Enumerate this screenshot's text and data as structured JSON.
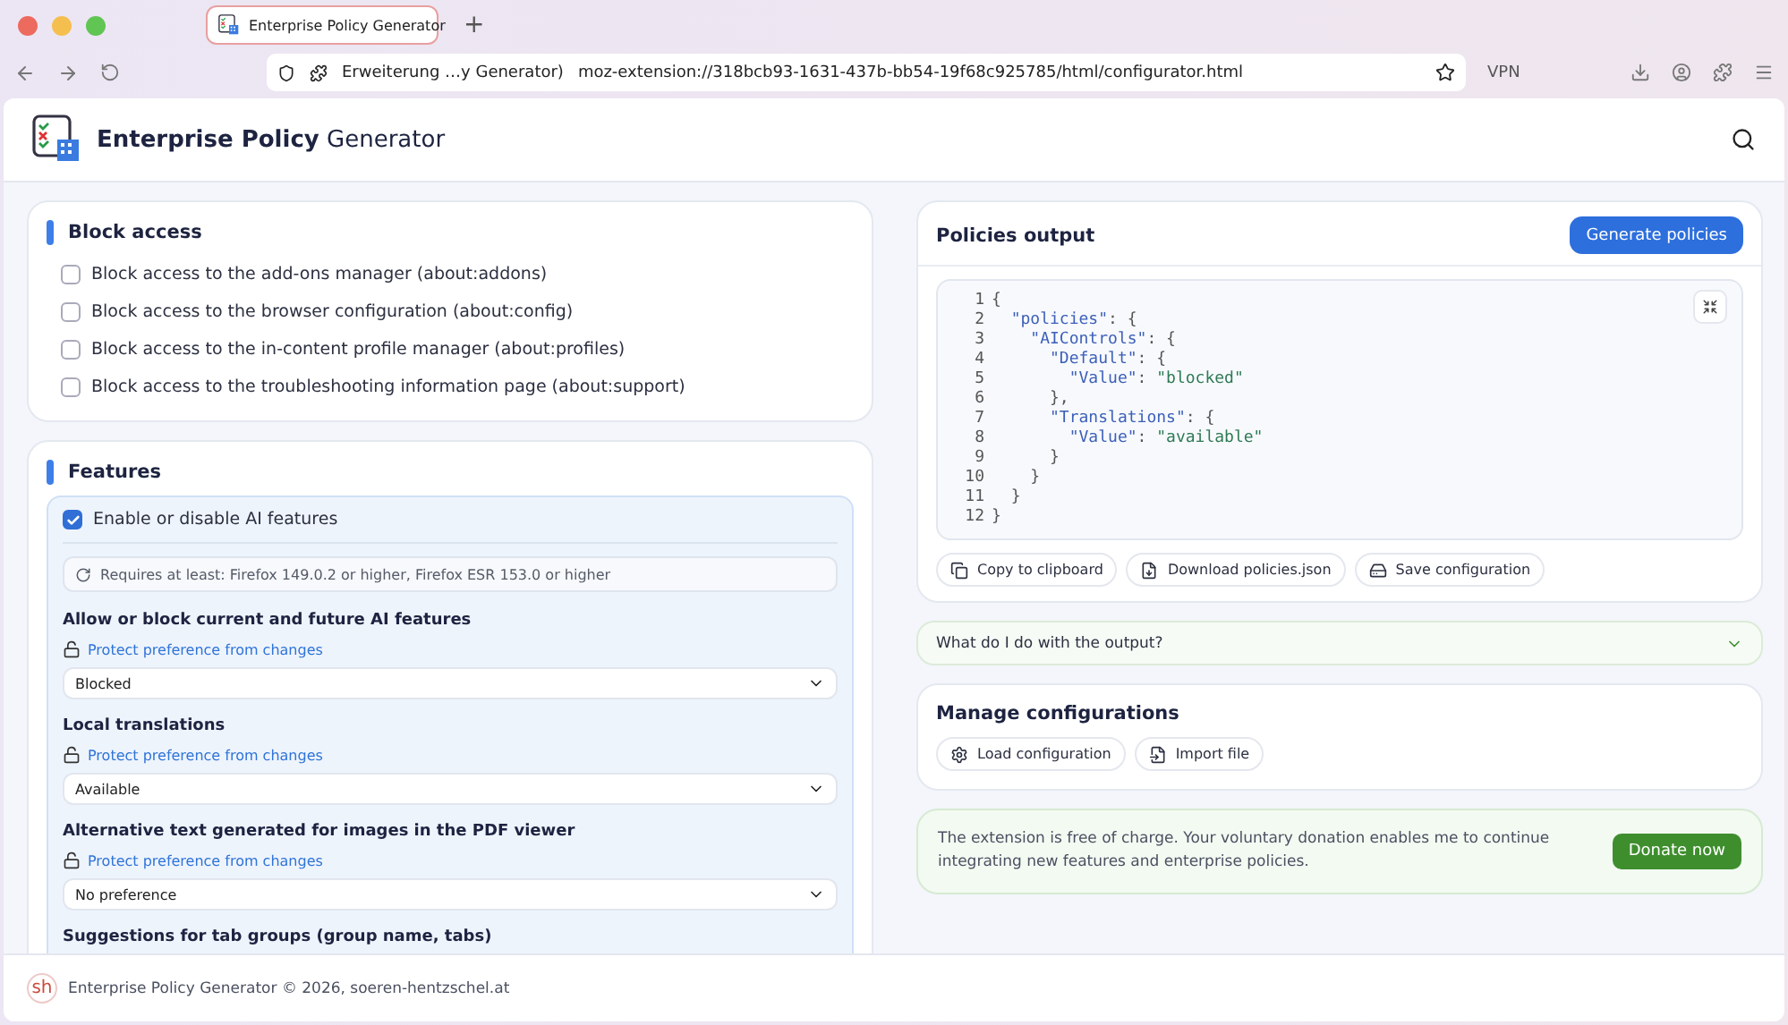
{
  "browser": {
    "tab_title": "Enterprise Policy Generator",
    "new_tab": "+",
    "url_label": "Erweiterung …y Generator)",
    "url": "moz-extension://318bcb93-1631-437b-bb54-19f68c925785/html/configurator.html",
    "vpn": "VPN"
  },
  "header": {
    "title_bold": "Enterprise Policy",
    "title_light": "Generator"
  },
  "block_access": {
    "title": "Block access",
    "items": [
      {
        "label": "Block access to the add-ons manager (about:addons)",
        "checked": false
      },
      {
        "label": "Block access to the browser configuration (about:config)",
        "checked": false
      },
      {
        "label": "Block access to the in-content profile manager (about:profiles)",
        "checked": false
      },
      {
        "label": "Block access to the troubleshooting information page (about:support)",
        "checked": false
      }
    ]
  },
  "features": {
    "title": "Features",
    "option": {
      "label": "Enable or disable AI features",
      "checked": true
    },
    "requirement": "Requires at least: Firefox 149.0.2 or higher, Firefox ESR 153.0 or higher",
    "settings": [
      {
        "title": "Allow or block current and future AI features",
        "protect": "Protect preference from changes",
        "value": "Blocked"
      },
      {
        "title": "Local translations",
        "protect": "Protect preference from changes",
        "value": "Available"
      },
      {
        "title": "Alternative text generated for images in the PDF viewer",
        "protect": "Protect preference from changes",
        "value": "No preference"
      },
      {
        "title": "Suggestions for tab groups (group name, tabs)"
      }
    ]
  },
  "output": {
    "title": "Policies output",
    "generate": "Generate policies",
    "lines": [
      {
        "number": "1",
        "parts": [
          {
            "kind": "punct",
            "text": "{"
          }
        ]
      },
      {
        "number": "2",
        "parts": [
          {
            "kind": "key",
            "text": "  \"policies\""
          },
          {
            "kind": "punct",
            "text": ": {"
          }
        ]
      },
      {
        "number": "3",
        "parts": [
          {
            "kind": "key",
            "text": "    \"AIControls\""
          },
          {
            "kind": "punct",
            "text": ": {"
          }
        ]
      },
      {
        "number": "4",
        "parts": [
          {
            "kind": "key",
            "text": "      \"Default\""
          },
          {
            "kind": "punct",
            "text": ": {"
          }
        ]
      },
      {
        "number": "5",
        "parts": [
          {
            "kind": "key",
            "text": "        \"Value\""
          },
          {
            "kind": "punct",
            "text": ": "
          },
          {
            "kind": "string",
            "text": "\"blocked\""
          }
        ]
      },
      {
        "number": "6",
        "parts": [
          {
            "kind": "punct",
            "text": "      },"
          }
        ]
      },
      {
        "number": "7",
        "parts": [
          {
            "kind": "key",
            "text": "      \"Translations\""
          },
          {
            "kind": "punct",
            "text": ": {"
          }
        ]
      },
      {
        "number": "8",
        "parts": [
          {
            "kind": "key",
            "text": "        \"Value\""
          },
          {
            "kind": "punct",
            "text": ": "
          },
          {
            "kind": "string",
            "text": "\"available\""
          }
        ]
      },
      {
        "number": "9",
        "parts": [
          {
            "kind": "punct",
            "text": "      }"
          }
        ]
      },
      {
        "number": "10",
        "parts": [
          {
            "kind": "punct",
            "text": "    }"
          }
        ]
      },
      {
        "number": "11",
        "parts": [
          {
            "kind": "punct",
            "text": "  }"
          }
        ]
      },
      {
        "number": "12",
        "parts": [
          {
            "kind": "punct",
            "text": "}"
          }
        ]
      }
    ],
    "actions": [
      {
        "kind": "copy",
        "label": "Copy to clipboard"
      },
      {
        "kind": "download",
        "label": "Download policies.json"
      },
      {
        "kind": "save",
        "label": "Save configuration"
      }
    ]
  },
  "faq": {
    "label": "What do I do with the output?",
    "expanded": false
  },
  "manage": {
    "title": "Manage configurations",
    "actions": [
      {
        "kind": "load",
        "label": "Load configuration"
      },
      {
        "kind": "import",
        "label": "Import file"
      }
    ]
  },
  "donate": {
    "text": "The extension is free of charge. Your voluntary donation enables me to continue integrating new features and enterprise policies.",
    "button": "Donate now"
  },
  "footer": {
    "logo": "sh",
    "text": "Enterprise Policy Generator © 2026, soeren-hentzschel.at"
  }
}
